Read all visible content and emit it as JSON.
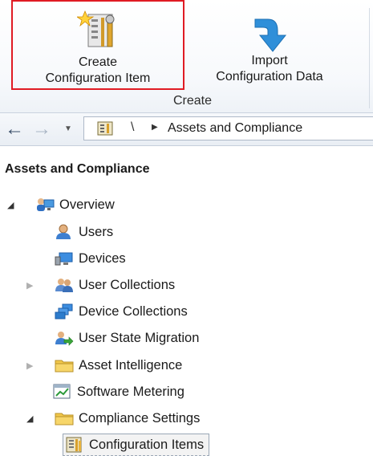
{
  "ribbon": {
    "create_ci": {
      "line1": "Create",
      "line2": "Configuration Item"
    },
    "import_cd": {
      "line1": "Import",
      "line2": "Configuration Data"
    },
    "group_label": "Create"
  },
  "address_bar": {
    "separator": "\\",
    "crumb": "Assets and Compliance"
  },
  "tree": {
    "title": "Assets and Compliance",
    "items": [
      {
        "label": "Overview",
        "icon": "overview-icon"
      },
      {
        "label": "Users",
        "icon": "user-icon"
      },
      {
        "label": "Devices",
        "icon": "devices-icon"
      },
      {
        "label": "User Collections",
        "icon": "user-collections-icon"
      },
      {
        "label": "Device Collections",
        "icon": "device-collections-icon"
      },
      {
        "label": "User State Migration",
        "icon": "user-state-migration-icon"
      },
      {
        "label": "Asset Intelligence",
        "icon": "folder-icon"
      },
      {
        "label": "Software Metering",
        "icon": "software-metering-icon"
      },
      {
        "label": "Compliance Settings",
        "icon": "folder-icon"
      },
      {
        "label": "Configuration Items",
        "icon": "configuration-item-icon"
      }
    ]
  },
  "colors": {
    "highlight_border": "#e01b24",
    "folder": "#f2c84b",
    "arrow_blue": "#2f8fd9"
  }
}
